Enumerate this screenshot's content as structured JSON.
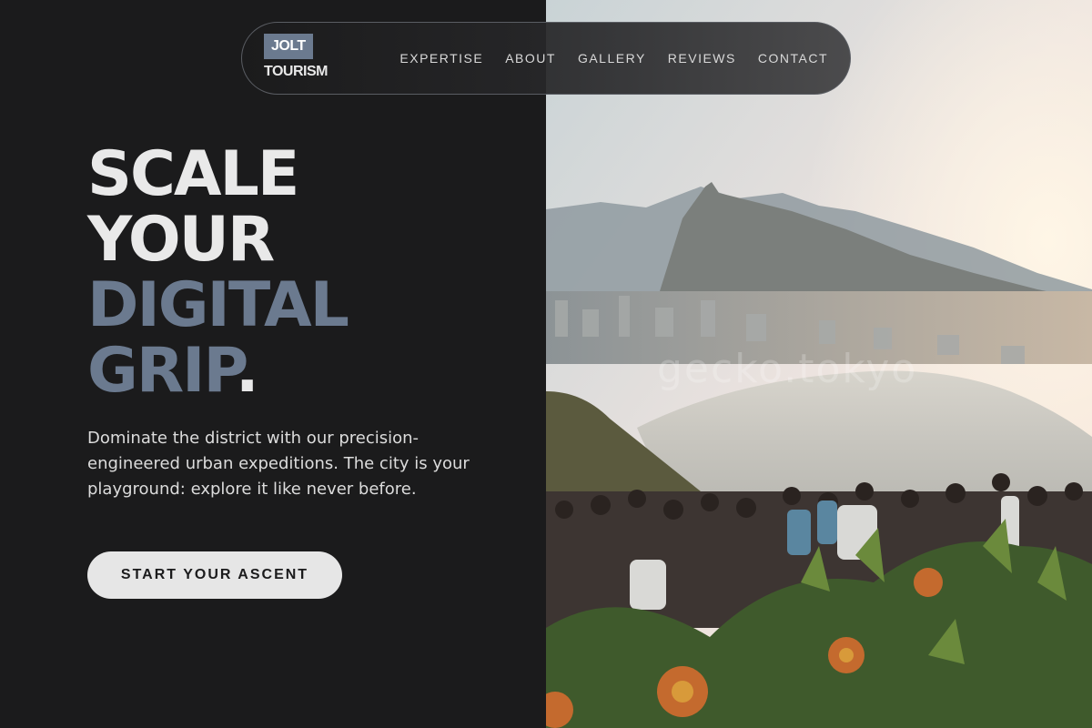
{
  "brand": {
    "logo_top": "JOLT",
    "logo_bottom": "TOURISM"
  },
  "nav": {
    "items": [
      "EXPERTISE",
      "ABOUT",
      "GALLERY",
      "REVIEWS",
      "CONTACT"
    ]
  },
  "hero": {
    "line1": "SCALE",
    "line2": "YOUR",
    "line3": "DIGITAL",
    "line4": "GRIP",
    "line4_suffix": ".",
    "description": "Dominate the district with our precision-engineered urban expeditions. The city is your playground: explore it like never before.",
    "cta_label": "START YOUR ASCENT"
  },
  "photo": {
    "watermark": "gecko.tokyo"
  },
  "colors": {
    "background": "#1b1b1c",
    "accent": "#6b7a8f",
    "text": "#e9e9e9",
    "button": "#e6e6e6"
  }
}
